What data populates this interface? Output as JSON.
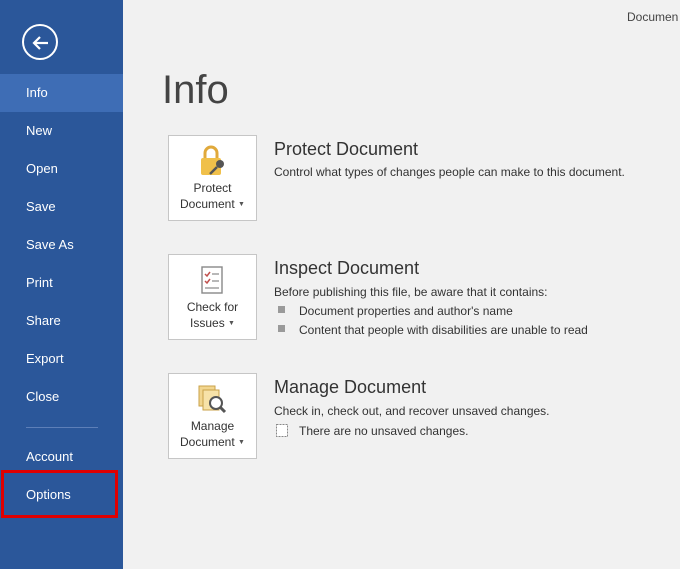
{
  "window": {
    "title": "Documen"
  },
  "nav": {
    "items": [
      {
        "label": "Info"
      },
      {
        "label": "New"
      },
      {
        "label": "Open"
      },
      {
        "label": "Save"
      },
      {
        "label": "Save As"
      },
      {
        "label": "Print"
      },
      {
        "label": "Share"
      },
      {
        "label": "Export"
      },
      {
        "label": "Close"
      },
      {
        "label": "Account"
      },
      {
        "label": "Options"
      }
    ],
    "active": "Info",
    "highlighted": "Options"
  },
  "page": {
    "heading": "Info"
  },
  "protect": {
    "tile_line1": "Protect",
    "tile_line2": "Document",
    "title": "Protect Document",
    "description": "Control what types of changes people can make to this document."
  },
  "inspect": {
    "tile_line1": "Check for",
    "tile_line2": "Issues",
    "title": "Inspect Document",
    "description": "Before publishing this file, be aware that it contains:",
    "bullets": [
      "Document properties and author's name",
      "Content that people with disabilities are unable to read"
    ]
  },
  "manage": {
    "tile_line1": "Manage",
    "tile_line2": "Document",
    "title": "Manage Document",
    "description": "Check in, check out, and recover unsaved changes.",
    "status": "There are no unsaved changes."
  },
  "colors": {
    "sidebar": "#2b579a",
    "active_item": "#3e6db5",
    "highlight_border": "#e00000"
  },
  "icons": [
    "back-arrow-icon",
    "padlock-key-icon",
    "checklist-icon",
    "document-magnifier-icon",
    "document-icon",
    "caret-down-icon"
  ]
}
